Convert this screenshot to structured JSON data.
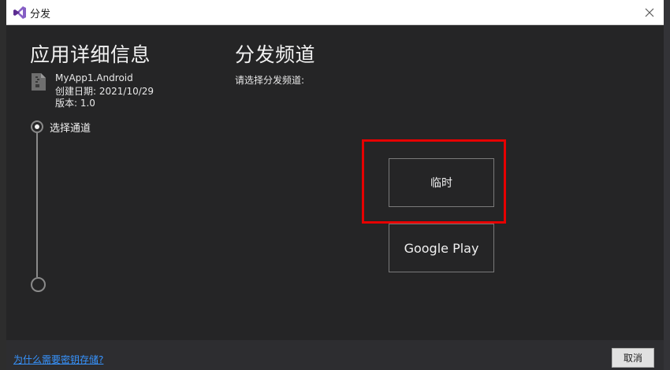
{
  "window": {
    "title": "分发",
    "close_icon": "close-icon",
    "app_icon": "visual-studio-icon"
  },
  "app_details": {
    "heading": "应用详细信息",
    "name": "MyApp1.Android",
    "created": "创建日期: 2021/10/29",
    "version": "版本: 1.0",
    "file_icon": "archive-file-icon"
  },
  "steps": [
    {
      "label": "选择通道",
      "active": true
    }
  ],
  "channel": {
    "heading": "分发频道",
    "instruction": "请选择分发频道:",
    "options": [
      {
        "label": "临时"
      },
      {
        "label": "Google Play"
      }
    ],
    "highlight_color": "#e60000"
  },
  "footer": {
    "help_link": "为什么需要密钥存储?",
    "cancel_label": "取消"
  },
  "colors": {
    "dialog_bg": "#252526",
    "text": "#f1f1f1",
    "link": "#3794ff"
  }
}
